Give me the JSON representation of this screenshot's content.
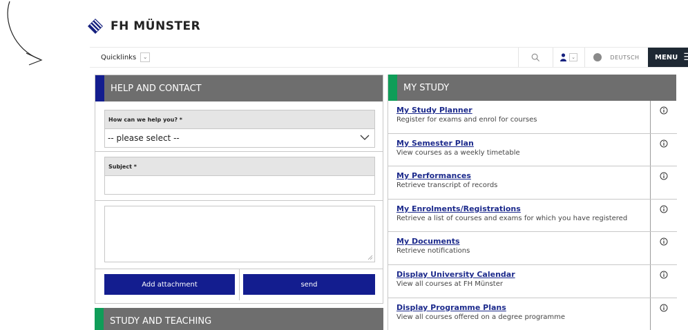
{
  "brand": {
    "name": "FH MÜNSTER"
  },
  "nav": {
    "quicklinks_label": "Quicklinks",
    "language_label": "DEUTSCH",
    "menu_label": "MENU",
    "caret_glyph": "⌄",
    "burger_glyph": "☰"
  },
  "help": {
    "title": "HELP AND CONTACT",
    "topic_label": "How can we help you? *",
    "topic_value": "-- please select --",
    "subject_label": "Subject *",
    "subject_value": "",
    "message_value": "",
    "attachment_button": "Add attachment",
    "send_button": "send"
  },
  "teaching": {
    "title": "STUDY AND TEACHING"
  },
  "study": {
    "title": "MY STUDY",
    "items": [
      {
        "label": "My Study Planner",
        "desc": "Register for exams and enrol for courses"
      },
      {
        "label": "My Semester Plan",
        "desc": "View courses as a weekly timetable"
      },
      {
        "label": "My Performances",
        "desc": "Retrieve transcript of records"
      },
      {
        "label": "My Enrolments/Registrations",
        "desc": "Retrieve a list of courses and exams for which you have registered"
      },
      {
        "label": "My Documents",
        "desc": "Retrieve notifications"
      },
      {
        "label": "Display University Calendar",
        "desc": "View all courses at FH Münster"
      },
      {
        "label": "Display Programme Plans",
        "desc": "View all courses offered on a degree programme"
      }
    ]
  },
  "colors": {
    "header_gray": "#6e6e6e",
    "accent_blue": "#131d8f",
    "accent_green": "#0f9d58",
    "menu_dark": "#1e2833",
    "link_blue": "#1c2a8c"
  },
  "icons": [
    "arrow-doodle",
    "logo-diamond-icon",
    "chevron-down-icon",
    "search-icon",
    "user-icon",
    "globe-icon",
    "hamburger-icon",
    "info-icon"
  ]
}
